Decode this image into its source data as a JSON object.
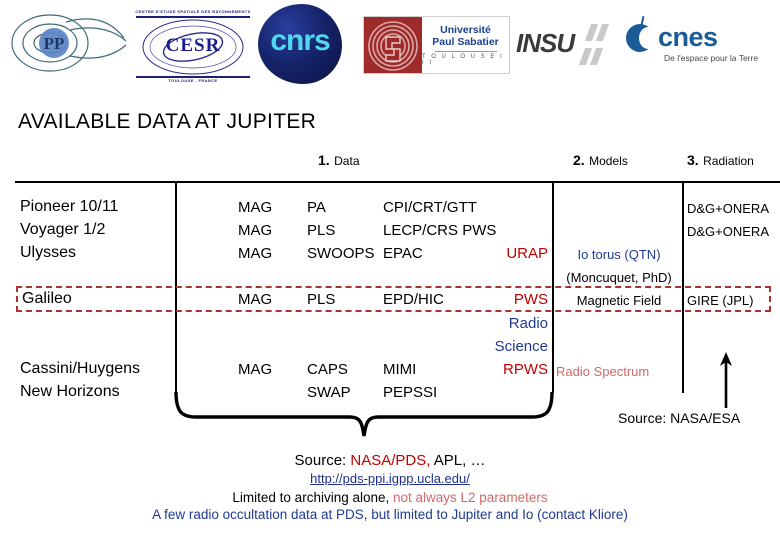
{
  "logos": [
    {
      "name": "ppi-logo",
      "alt": "PPI magnetosphere logo"
    },
    {
      "name": "cesr-logo",
      "alt": "CESR",
      "word": "CESR",
      "top_text": "CENTRE D'ETUDE SPATIALE DES RAYONNEMENTS",
      "bottom_text": "TOULOUSE - FRANCE",
      "ring_text": "CENTRE D'ETUDE SPATIALE DES RAYONNEMENTS"
    },
    {
      "name": "cnrs-logo",
      "alt": "CNRS",
      "word": "cnrs"
    },
    {
      "name": "universite-paul-sabatier-logo",
      "line1": "Université",
      "line2": "Paul Sabatier",
      "line3": "T O U L O U S E   I I I"
    },
    {
      "name": "insu-logo",
      "word": "INSU"
    },
    {
      "name": "cnes-logo",
      "word": "cnes",
      "tagline": "De l'espace pour la Terre"
    }
  ],
  "title": "AVAILABLE DATA AT JUPITER",
  "column_headers": [
    {
      "num": "1.",
      "label": "Data"
    },
    {
      "num": "2.",
      "label": "Models"
    },
    {
      "num": "3.",
      "label": "Radiation"
    }
  ],
  "table": {
    "missions": [
      {
        "name": "Pioneer  10/11"
      },
      {
        "name": "Voyager  1/2"
      },
      {
        "name": "Ulysses"
      },
      {
        "name": "Galileo"
      },
      {
        "name": "Cassini/Huygens"
      },
      {
        "name": "New Horizons"
      }
    ],
    "data_column": {
      "pioneer": {
        "mag": "MAG",
        "plasma": "PA",
        "instruments": "CPI/CRT/GTT",
        "radio": ""
      },
      "voyager": {
        "mag": "MAG",
        "plasma": "PLS",
        "instruments": "LECP/CRS PWS",
        "radio": ""
      },
      "ulysses": {
        "mag": "MAG",
        "plasma": "SWOOPS",
        "instruments": "EPAC",
        "radio": "URAP"
      },
      "galileo": {
        "mag": "MAG",
        "plasma": "PLS",
        "instruments": "EPD/HIC",
        "radio": "PWS"
      },
      "cassini": {
        "mag": "MAG",
        "plasma": "CAPS",
        "instruments": "MIMI",
        "radio": "RPWS"
      },
      "new_horizons": {
        "mag": "",
        "plasma": "SWAP",
        "instruments": "PEPSSI",
        "radio": ""
      },
      "radio_extra_line1": "Radio",
      "radio_extra_line2": "Science"
    },
    "models_column": {
      "io_torus": "Io torus (QTN)",
      "io_torus_ref": "(Moncuquet, PhD)",
      "magnetic_field": "Magnetic Field",
      "radio_spectrum": "Radio Spectrum"
    },
    "radiation_column": {
      "pioneer": "D&G+ONERA",
      "voyager": "D&G+ONERA",
      "galileo": "GIRE (JPL)"
    }
  },
  "annotations": {
    "source_nasa_esa": "Source: NASA/ESA",
    "arrow": "up-arrow"
  },
  "footer": {
    "source_prefix": "Source: ",
    "source_red": "NASA/PDS,",
    "source_suffix": " APL, …",
    "url": "http://pds-ppi.igpp.ucla.edu/",
    "note1_black": "Limited to archiving alone, ",
    "note1_red": "not always L2 parameters",
    "note2": "A few radio occultation data at PDS, but limited to Jupiter and Io (contact Kliore)"
  },
  "colors": {
    "red": "#c00000",
    "dark_red_dash": "#a83232",
    "blue": "#1f3a93",
    "link_blue": "#1f2f8f",
    "salmon": "#d06a6a"
  }
}
